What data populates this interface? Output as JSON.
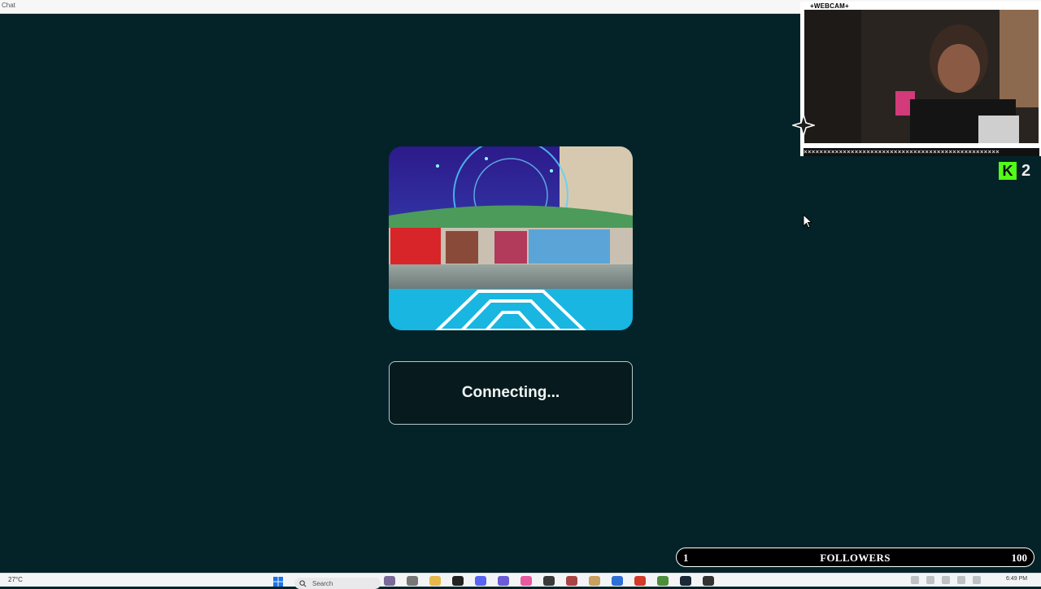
{
  "window": {
    "title": "Chat"
  },
  "world": {
    "image": "vrchat-world-thumbnail"
  },
  "status": {
    "message": "Connecting..."
  },
  "webcam": {
    "label": "+WEBCAM+",
    "strip_text": "××××××××××××××××××××××××××××××××××××××××××××××××××"
  },
  "kick": {
    "logo_letter": "K",
    "viewer_count": "2",
    "color": "#53fc18"
  },
  "followers_goal": {
    "start": "1",
    "label": "FOLLOWERS",
    "end": "100",
    "progress": 0.0
  },
  "taskbar": {
    "weather": "27°C",
    "search_placeholder": "Search",
    "clock": "6:49 PM",
    "apps": [
      {
        "name": "app-game",
        "color": "#7a6a9a"
      },
      {
        "name": "app-taskview",
        "color": "#777777"
      },
      {
        "name": "app-file-explorer",
        "color": "#e8b84a"
      },
      {
        "name": "app-capcut",
        "color": "#222222"
      },
      {
        "name": "app-discord",
        "color": "#5865f2"
      },
      {
        "name": "app-dd",
        "color": "#6b5bd6"
      },
      {
        "name": "app-pink",
        "color": "#e85aa0"
      },
      {
        "name": "app-obs",
        "color": "#3a3a3a"
      },
      {
        "name": "app-roblox-studio",
        "color": "#aa4444"
      },
      {
        "name": "app-notes",
        "color": "#c8a060"
      },
      {
        "name": "app-blue",
        "color": "#2f6fd6"
      },
      {
        "name": "app-red",
        "color": "#d33a2a"
      },
      {
        "name": "app-chrome",
        "color": "#4a8f3a"
      },
      {
        "name": "app-steam",
        "color": "#1b2838"
      },
      {
        "name": "app-vrchat",
        "color": "#333333"
      }
    ]
  }
}
